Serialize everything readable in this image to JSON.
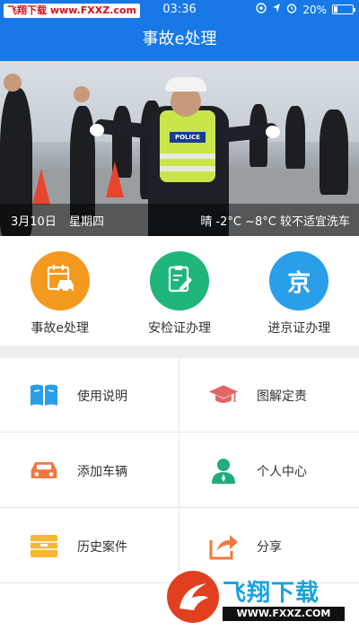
{
  "status_bar": {
    "watermark": "飞翔下载 www.FXXZ.com",
    "time": "03:36",
    "battery": "20%",
    "battery_level": 0.2
  },
  "nav": {
    "title": "事故e处理"
  },
  "banner": {
    "police_tag": "POLICE",
    "date": "3月10日",
    "weekday": "星期四",
    "weather": "晴  -2°C ~8°C  较不适宜洗车",
    "dots_count": 5,
    "active_dot": 1
  },
  "quick_actions": [
    {
      "label": "事故e处理",
      "color": "#f39a1e",
      "icon": "accident-car-icon"
    },
    {
      "label": "安检证办理",
      "color": "#1fb57b",
      "icon": "document-pen-icon"
    },
    {
      "label": "进京证办理",
      "color": "#2a9ee8",
      "icon_text": "京",
      "icon": "beijing-icon"
    }
  ],
  "menu": [
    {
      "label": "使用说明",
      "icon": "book-icon",
      "color": "#2a9ee8"
    },
    {
      "label": "图解定责",
      "icon": "graduation-cap-icon",
      "color": "#e06767"
    },
    {
      "label": "添加车辆",
      "icon": "car-icon",
      "color": "#f07a3e"
    },
    {
      "label": "个人中心",
      "icon": "user-icon",
      "color": "#1fae7a"
    },
    {
      "label": "历史案件",
      "icon": "folder-icon",
      "color": "#f7b731"
    },
    {
      "label": "分享",
      "icon": "share-icon",
      "color": "#f07a3e"
    }
  ],
  "watermark_footer": {
    "title": "飞翔下载",
    "url": "WWW.FXXZ.COM"
  }
}
